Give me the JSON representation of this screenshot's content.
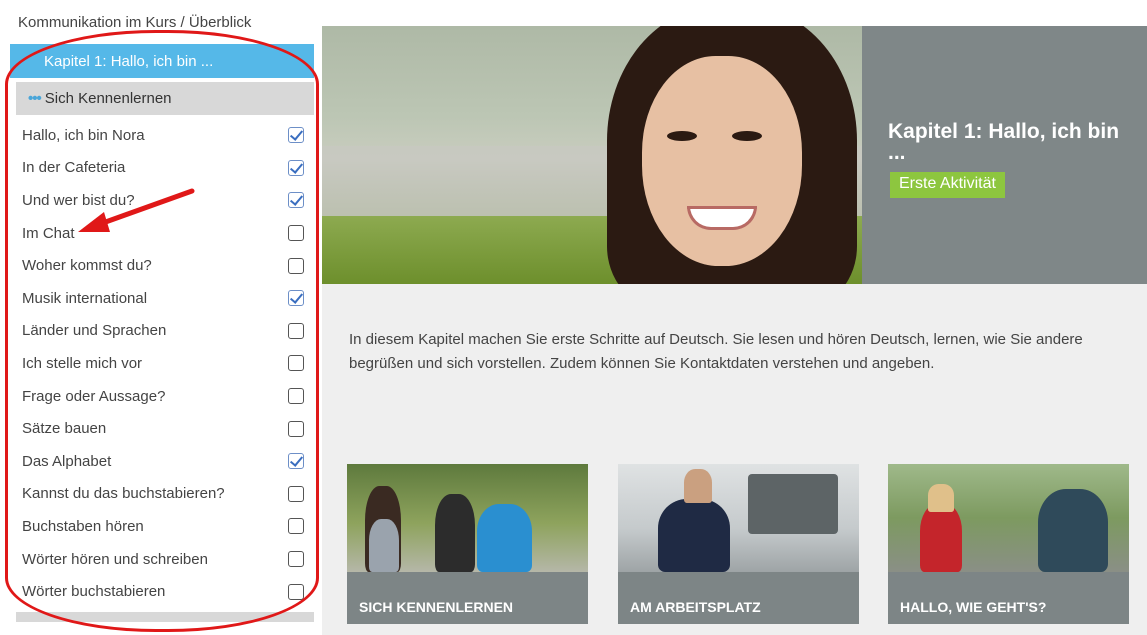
{
  "sidebar": {
    "breadcrumb": "Kommunikation im Kurs / Überblick",
    "chapter": "Kapitel 1: Hallo, ich bin ...",
    "section": "Sich Kennenlernen",
    "lessons": [
      {
        "label": "Hallo, ich bin Nora",
        "checked": true
      },
      {
        "label": "In der Cafeteria",
        "checked": true
      },
      {
        "label": "Und wer bist du?",
        "checked": true
      },
      {
        "label": "Im Chat",
        "checked": false
      },
      {
        "label": "Woher kommst du?",
        "checked": false
      },
      {
        "label": "Musik international",
        "checked": true
      },
      {
        "label": "Länder und Sprachen",
        "checked": false
      },
      {
        "label": "Ich stelle mich vor",
        "checked": false
      },
      {
        "label": "Frage oder Aussage?",
        "checked": false
      },
      {
        "label": "Sätze bauen",
        "checked": false
      },
      {
        "label": "Das Alphabet",
        "checked": true
      },
      {
        "label": "Kannst du das buchstabieren?",
        "checked": false
      },
      {
        "label": "Buchstaben hören",
        "checked": false
      },
      {
        "label": "Wörter hören und schreiben",
        "checked": false
      },
      {
        "label": "Wörter buchstabieren",
        "checked": false
      }
    ]
  },
  "hero": {
    "title": "Kapitel 1: Hallo, ich bin ...",
    "cta": "Erste Aktivität"
  },
  "intro": "In diesem Kapitel machen Sie erste Schritte auf Deutsch. Sie lesen und hören Deutsch, lernen, wie Sie andere begrüßen und sich vorstellen. Zudem können Sie Kontaktdaten verstehen und angeben.",
  "cards": [
    {
      "caption": "SICH KENNENLERNEN"
    },
    {
      "caption": "AM ARBEITSPLATZ"
    },
    {
      "caption": "HALLO, WIE GEHT'S?"
    }
  ],
  "colors": {
    "chapter_bar": "#55b8e8",
    "cta_green": "#8dc63f",
    "panel_gray": "#7f8788",
    "annotation_red": "#e01818"
  }
}
